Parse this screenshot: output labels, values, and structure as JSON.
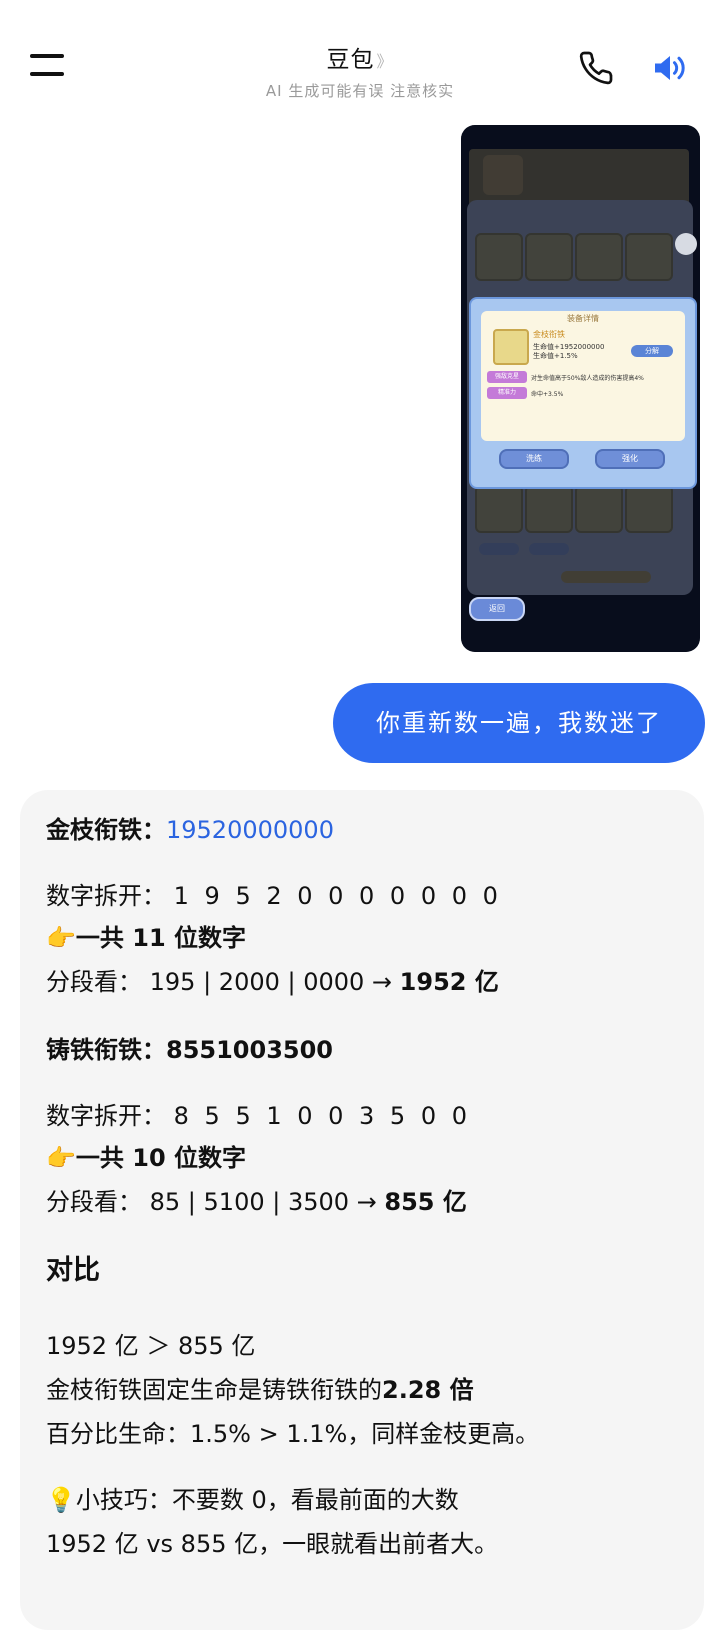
{
  "header": {
    "title": "豆包",
    "title_chevron": "》",
    "subtitle": "AI 生成可能有误 注意核实"
  },
  "screenshot": {
    "dialog_title": "装备详情",
    "item_name": "金枝衔铁",
    "stat1": "生命值+1952000000",
    "stat2": "生命值+1.5%",
    "btn_fenjie": "分解",
    "tag1": "强敌克星",
    "effect1": "对生命值高于50%敌人造成的伤害提高4%",
    "tag2": "精准力",
    "effect2": "命中+3.5%",
    "btn_wash": "洗练",
    "btn_strengthen": "强化",
    "btn_back": "返回"
  },
  "user_message": "你重新数一遍，我数迷了",
  "answer": {
    "item1_label": "金枝衔铁：",
    "item1_value": "19520000000",
    "item1_digits_label": "数字拆开：",
    "item1_digits": "1 9 5 2 0 0 0 0 0 0 0",
    "item1_count_emoji": "👉",
    "item1_count": "一共 11 位数字",
    "item1_segment_label": "分段看：",
    "item1_segment": "195 | 2000 | 0000 →",
    "item1_result": "1952 亿",
    "item2_label": "铸铁衔铁：8551003500",
    "item2_digits_label": "数字拆开：",
    "item2_digits": "8 5 5 1 0 0 3 5 0 0",
    "item2_count_emoji": "👉",
    "item2_count": "一共 10 位数字",
    "item2_segment_label": "分段看：",
    "item2_segment": "85 | 5100 | 3500 →",
    "item2_result": "855 亿",
    "compare_heading": "对比",
    "compare_line1": "1952 亿 ＞ 855 亿",
    "compare_line2_pre": "金枝衔铁固定生命是铸铁衔铁的",
    "compare_line2_bold": "2.28 倍",
    "compare_line3": "百分比生命：1.5% > 1.1%，同样金枝更高。",
    "tip_emoji": "💡",
    "tip_line1": "小技巧：不要数 0，看最前面的大数",
    "tip_line2": "1952 亿 vs 855 亿，一眼就看出前者大。"
  }
}
